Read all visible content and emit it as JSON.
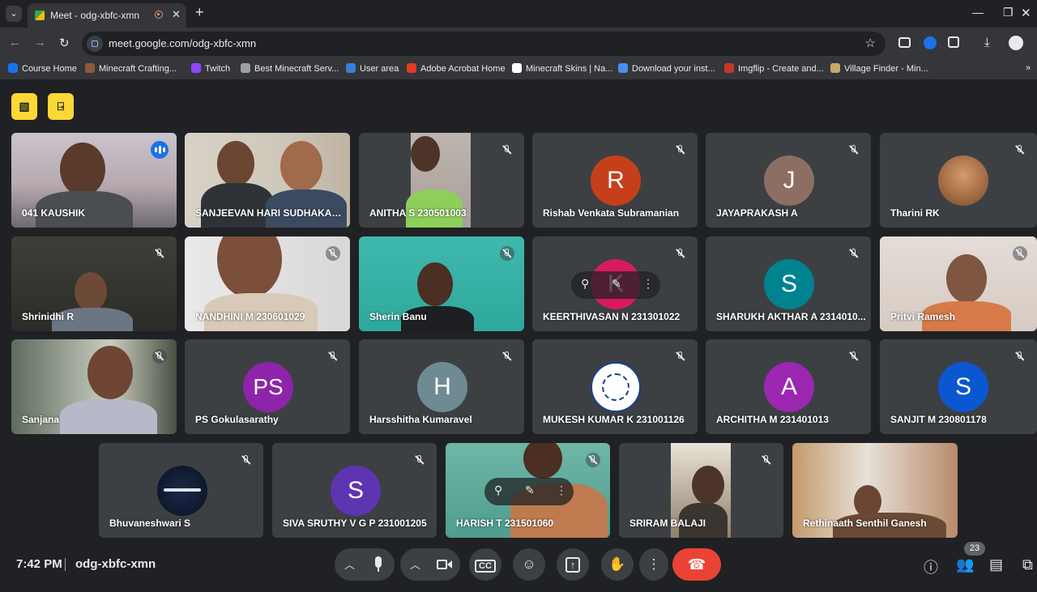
{
  "browser": {
    "tab_title": "Meet - odg-xbfc-xmn",
    "url": "meet.google.com/odg-xbfc-xmn",
    "bookmarks": [
      {
        "label": "Course Home",
        "color": "#1a73e8"
      },
      {
        "label": "Minecraft Crafting...",
        "color": "#8d5a3b"
      },
      {
        "label": "Twitch",
        "color": "#9146ff"
      },
      {
        "label": "Best Minecraft Serv...",
        "color": "#9aa0a6"
      },
      {
        "label": "User area",
        "color": "#3b7dd8"
      },
      {
        "label": "Adobe Acrobat Home",
        "color": "#e33b24"
      },
      {
        "label": "Minecraft Skins | Na...",
        "color": "#ffffff"
      },
      {
        "label": "Download your inst...",
        "color": "#4d8df5"
      },
      {
        "label": "Imgflip - Create and...",
        "color": "#c0392b"
      },
      {
        "label": "Village Finder - Min...",
        "color": "#c9a66b"
      }
    ]
  },
  "meeting": {
    "time": "7:42 PM",
    "code": "odg-xbfc-xmn",
    "participant_count": "23"
  },
  "participants": [
    {
      "name": "041 KAUSHIK",
      "type": "video",
      "speaking": true
    },
    {
      "name": "SANJEEVAN HARI SUDHAKAR...",
      "type": "video"
    },
    {
      "name": "ANITHA S 230501003",
      "type": "video",
      "muted": true
    },
    {
      "name": "Rishab Venkata Subramanian",
      "type": "avatar",
      "initial": "R",
      "color": "#c5401a",
      "muted": true
    },
    {
      "name": "JAYAPRAKASH A",
      "type": "avatar",
      "initial": "J",
      "color": "#8d6e63",
      "muted": true
    },
    {
      "name": "Tharini RK",
      "type": "photo",
      "muted": true
    },
    {
      "name": "Shrinidhi R",
      "type": "video",
      "muted": true
    },
    {
      "name": "NANDHINI M 230601029",
      "type": "video",
      "muted": true
    },
    {
      "name": "Sherin Banu",
      "type": "video",
      "muted": true
    },
    {
      "name": "KEERTHIVASAN N 231301022",
      "type": "avatar",
      "initial": "K",
      "color": "#d81b60",
      "muted": true
    },
    {
      "name": "SHARUKH AKTHAR A 2314010...",
      "type": "avatar",
      "initial": "S",
      "color": "#00838f",
      "muted": true
    },
    {
      "name": "Pritvi Ramesh",
      "type": "video",
      "muted": true
    },
    {
      "name": "Sanjana",
      "type": "video",
      "muted": true
    },
    {
      "name": "PS Gokulasarathy",
      "type": "avatar",
      "initial": "PS",
      "color": "#8e24aa",
      "muted": true
    },
    {
      "name": "Harsshitha Kumaravel",
      "type": "avatar",
      "initial": "H",
      "color": "#6e8b94",
      "muted": true
    },
    {
      "name": "MUKESH KUMAR K 231001126",
      "type": "logo",
      "muted": true
    },
    {
      "name": "ARCHITHA M 231401013",
      "type": "avatar",
      "initial": "A",
      "color": "#9c27b0",
      "muted": true
    },
    {
      "name": "SANJIT M 230801178",
      "type": "avatar",
      "initial": "S",
      "color": "#0b57d0",
      "muted": true
    },
    {
      "name": "Bhuvaneshwari S",
      "type": "photo",
      "muted": true
    },
    {
      "name": "SIVA SRUTHY V G P 231001205",
      "type": "avatar",
      "initial": "S",
      "color": "#5e35b1",
      "muted": true
    },
    {
      "name": "HARISH T 231501060",
      "type": "video",
      "muted": true
    },
    {
      "name": "SRIRAM BALAJI",
      "type": "video",
      "muted": true
    },
    {
      "name": "Rethinaath Senthil Ganesh",
      "type": "video"
    }
  ]
}
